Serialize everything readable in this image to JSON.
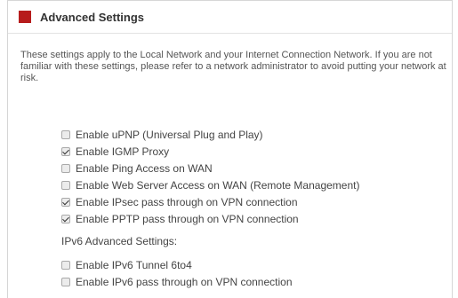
{
  "header": {
    "title": "Advanced Settings",
    "accent_color": "#b71c1c"
  },
  "description": "These settings apply to the Local Network and your Internet Connection Network. If you are not familiar with these settings, please refer to a network administrator to avoid putting your network at risk.",
  "options": [
    {
      "label": "Enable uPNP (Universal Plug and Play)",
      "checked": false
    },
    {
      "label": "Enable IGMP Proxy",
      "checked": true
    },
    {
      "label": "Enable Ping Access on WAN",
      "checked": false
    },
    {
      "label": "Enable Web Server Access on WAN (Remote Management)",
      "checked": false
    },
    {
      "label": "Enable IPsec pass through on VPN connection",
      "checked": true
    },
    {
      "label": "Enable PPTP pass through on VPN connection",
      "checked": true
    }
  ],
  "ipv6": {
    "section_label": "IPv6 Advanced Settings:",
    "options": [
      {
        "label": "Enable IPv6 Tunnel 6to4",
        "checked": false
      },
      {
        "label": "Enable IPv6 pass through on VPN connection",
        "checked": false
      }
    ]
  }
}
